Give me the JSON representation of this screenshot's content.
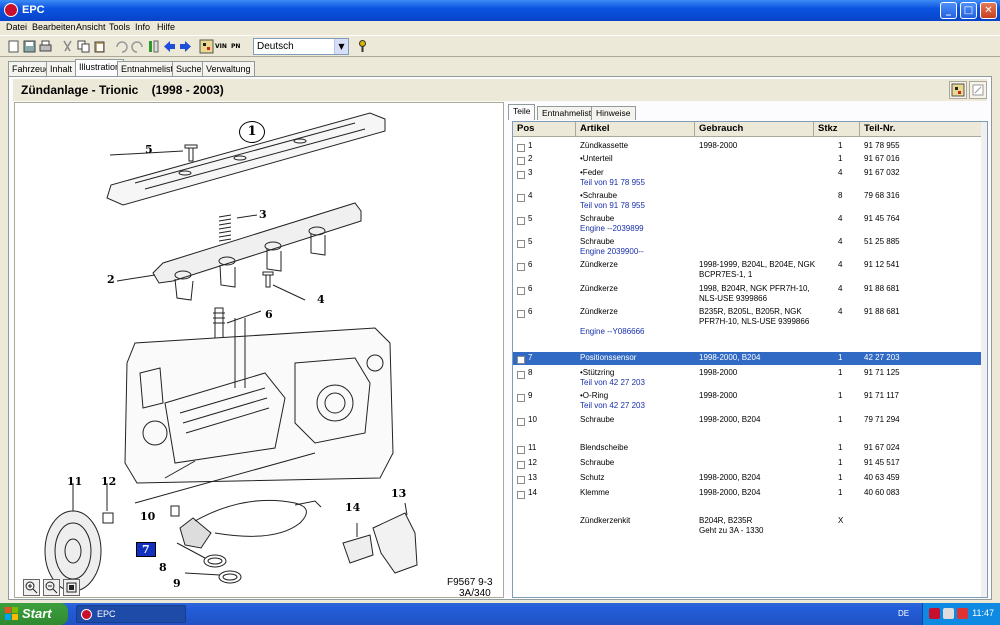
{
  "window": {
    "title": "EPC"
  },
  "menu": [
    "Datei",
    "Bearbeiten",
    "Ansicht",
    "Tools",
    "Info",
    "Hilfe"
  ],
  "toolbar": {
    "language": "Deutsch",
    "vin_label": "VIN",
    "pnc_label": "PN"
  },
  "main_tabs": [
    "Fahrzeug",
    "Inhalt",
    "Illustration",
    "Entnahmeliste",
    "Suche",
    "Verwaltung"
  ],
  "main_active_tab": "Illustration",
  "header": {
    "title": "Zündanlage - Trionic    (1998 - 2003)"
  },
  "illustration": {
    "callouts": [
      "1",
      "2",
      "3",
      "4",
      "5",
      "6",
      "7",
      "8",
      "9",
      "10",
      "11",
      "12",
      "13",
      "14"
    ],
    "highlighted": "7",
    "figure_ref": "F9567 9-3",
    "figure_page": "3A/340"
  },
  "sub_tabs": [
    "Teile",
    "Entnahmeliste",
    "Hinweise"
  ],
  "sub_active_tab": "Teile",
  "table": {
    "columns": [
      "Pos",
      "Artikel",
      "Gebrauch",
      "Stkz",
      "Teil-Nr."
    ],
    "rows": [
      {
        "pos": "1",
        "artikel": "Zündkassette",
        "artikel2": "",
        "gebrauch": "1998-2000",
        "stkz": "1",
        "teil": "91 78 955"
      },
      {
        "pos": "2",
        "artikel": "•Unterteil",
        "artikel2": "",
        "gebrauch": "",
        "stkz": "1",
        "teil": "91 67 016"
      },
      {
        "pos": "3",
        "artikel": "•Feder",
        "artikel2": "Teil von 91 78 955",
        "gebrauch": "",
        "stkz": "4",
        "teil": "91 67 032"
      },
      {
        "pos": "4",
        "artikel": "•Schraube",
        "artikel2": "Teil von 91 78 955",
        "gebrauch": "",
        "stkz": "8",
        "teil": "79 68 316"
      },
      {
        "pos": "5",
        "artikel": "Schraube",
        "artikel2": "Engine --2039899",
        "gebrauch": "",
        "stkz": "4",
        "teil": "91 45 764"
      },
      {
        "pos": "5",
        "artikel": "Schraube",
        "artikel2": "Engine 2039900--",
        "gebrauch": "",
        "stkz": "4",
        "teil": "51 25 885"
      },
      {
        "pos": "6",
        "artikel": "Zündkerze",
        "artikel2": "",
        "gebrauch": "1998-1999, B204L, B204E, NGK\nBCPR7ES-1, 1",
        "stkz": "4",
        "teil": "91 12 541"
      },
      {
        "pos": "6",
        "artikel": "Zündkerze",
        "artikel2": "",
        "gebrauch": "1998, B204R, NGK PFR7H-10,\nNLS-USE 9399866",
        "stkz": "4",
        "teil": "91 88 681"
      },
      {
        "pos": "6",
        "artikel": "Zündkerze",
        "artikel2": "Engine --Y086666",
        "gebrauch": "B235R, B205L, B205R, NGK\nPFR7H-10, NLS-USE 9399866",
        "stkz": "4",
        "teil": "91 88 681"
      },
      {
        "pos": "7",
        "artikel": "Positionssensor",
        "artikel2": "",
        "gebrauch": "1998-2000, B204",
        "stkz": "1",
        "teil": "42 27 203",
        "selected": true
      },
      {
        "pos": "8",
        "artikel": "•Stützring",
        "artikel2": "Teil von 42 27 203",
        "gebrauch": "1998-2000",
        "stkz": "1",
        "teil": "91 71 125"
      },
      {
        "pos": "9",
        "artikel": "•O-Ring",
        "artikel2": "Teil von 42 27 203",
        "gebrauch": "1998-2000",
        "stkz": "1",
        "teil": "91 71 117"
      },
      {
        "pos": "10",
        "artikel": "Schraube",
        "artikel2": "",
        "gebrauch": "1998-2000, B204",
        "stkz": "1",
        "teil": "79 71 294"
      },
      {
        "pos": "11",
        "artikel": "Blendscheibe",
        "artikel2": "",
        "gebrauch": "",
        "stkz": "1",
        "teil": "91 67 024"
      },
      {
        "pos": "12",
        "artikel": "Schraube",
        "artikel2": "",
        "gebrauch": "",
        "stkz": "1",
        "teil": "91 45 517"
      },
      {
        "pos": "13",
        "artikel": "Schutz",
        "artikel2": "",
        "gebrauch": "1998-2000, B204",
        "stkz": "1",
        "teil": "40 63 459"
      },
      {
        "pos": "14",
        "artikel": "Klemme",
        "artikel2": "",
        "gebrauch": "1998-2000, B204",
        "stkz": "1",
        "teil": "40 60 083"
      },
      {
        "pos": "",
        "artikel": "Zündkerzenkit",
        "artikel2": "",
        "gebrauch": "B204R, B235R\nGeht zu 3A - 1330",
        "stkz": "X",
        "teil": "",
        "nocheck": true
      }
    ]
  },
  "taskbar": {
    "start": "Start",
    "app": "EPC",
    "lang": "DE",
    "clock": "11:47"
  },
  "colors": {
    "selection": "#316ac5",
    "highlight_callout": "#1030c0",
    "titlebar": "#0a54e0"
  }
}
